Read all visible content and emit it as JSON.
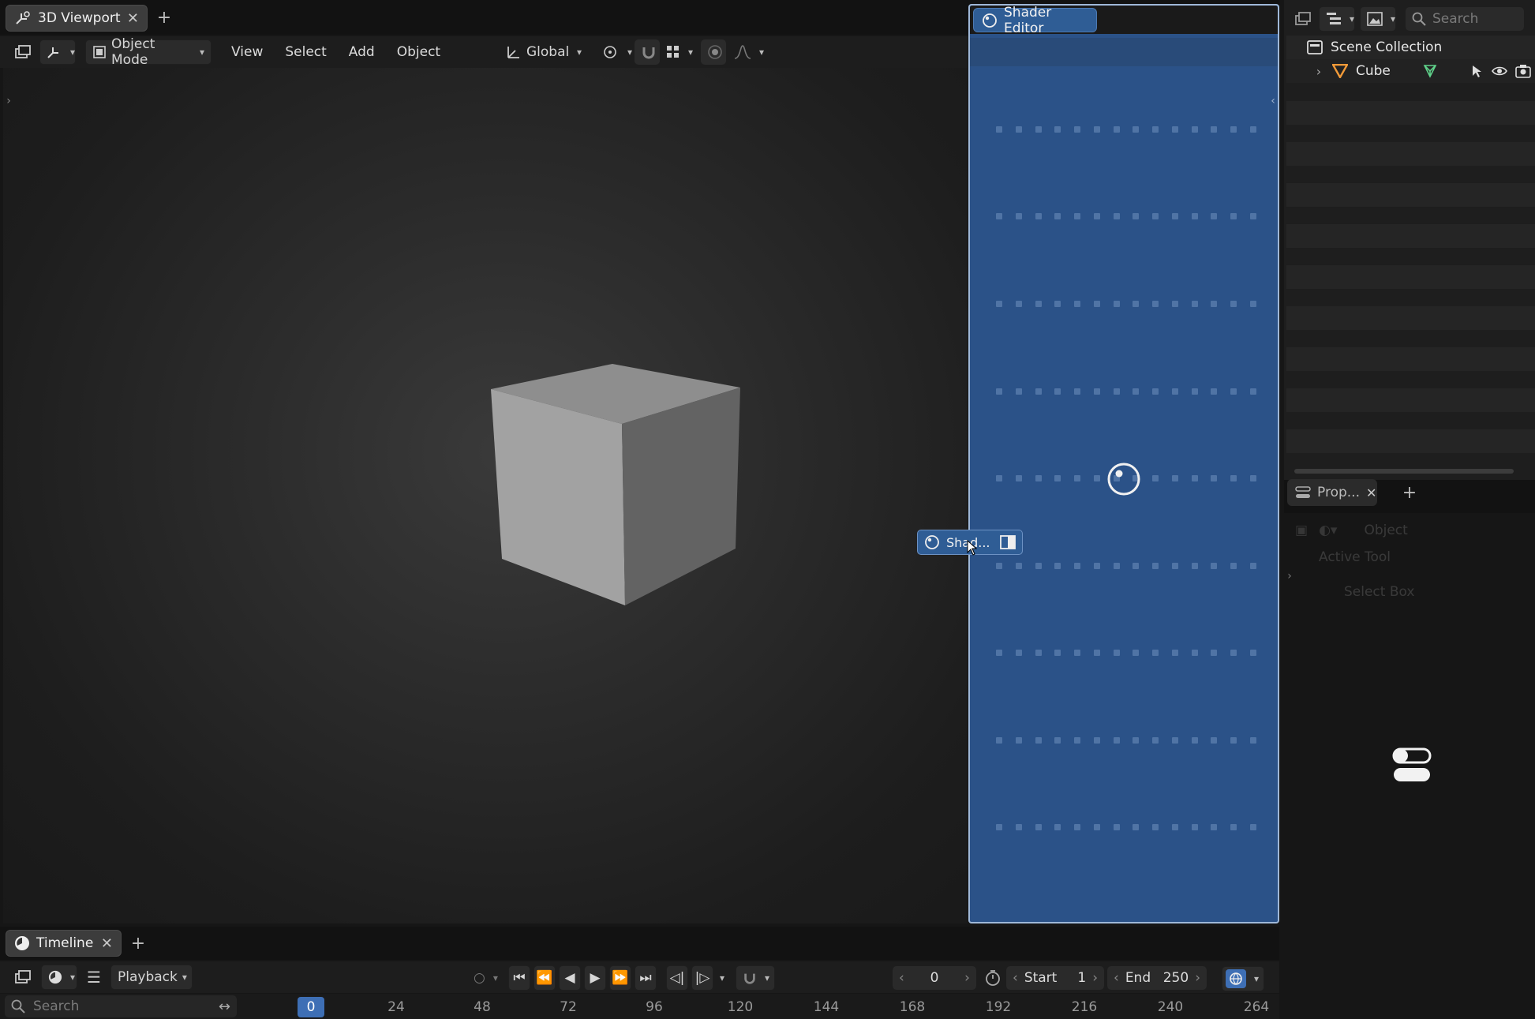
{
  "viewport": {
    "tab_label": "3D Viewport",
    "mode": "Object Mode",
    "menu": [
      "View",
      "Select",
      "Add",
      "Object"
    ],
    "orientation": "Global"
  },
  "shader_editor": {
    "tab_label": "Shader Editor",
    "drag_label": "Shad..."
  },
  "outliner": {
    "search_placeholder": "Search",
    "scene_collection": "Scene Collection",
    "cube": "Cube"
  },
  "properties": {
    "tab_label": "Prop...",
    "mode_label": "Object",
    "section": "Active Tool",
    "tool": "Select Box"
  },
  "timeline": {
    "tab_label": "Timeline",
    "playback": "Playback",
    "current_frame": "0",
    "start_label": "Start",
    "start_value": "1",
    "end_label": "End",
    "end_value": "250",
    "search_placeholder": "Search",
    "ruler_current": "0",
    "ruler": [
      "24",
      "48",
      "72",
      "96",
      "120",
      "144",
      "168",
      "192",
      "216",
      "240",
      "264"
    ]
  },
  "colors": {
    "accent_blue": "#2f5d95",
    "frame_indicator": "#3e6fb5",
    "panel_bg": "#303030"
  }
}
